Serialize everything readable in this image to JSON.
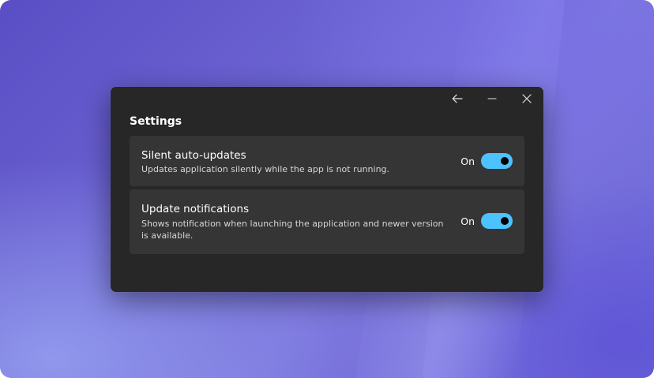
{
  "window": {
    "title": "Settings",
    "controls": {
      "back_icon": "arrow-left-icon",
      "minimize_icon": "minimize-icon",
      "close_icon": "close-icon"
    }
  },
  "settings": [
    {
      "title": "Silent auto-updates",
      "description": "Updates application silently while the app is not running.",
      "state_label": "On",
      "enabled": true
    },
    {
      "title": "Update notifications",
      "description": "Shows notification when launching the application and newer version is available.",
      "state_label": "On",
      "enabled": true
    }
  ],
  "colors": {
    "window_bg": "#272727",
    "card_bg": "#353535",
    "accent": "#4cc2ff",
    "text_primary": "#ffffff",
    "text_secondary": "#d6d6d6"
  }
}
